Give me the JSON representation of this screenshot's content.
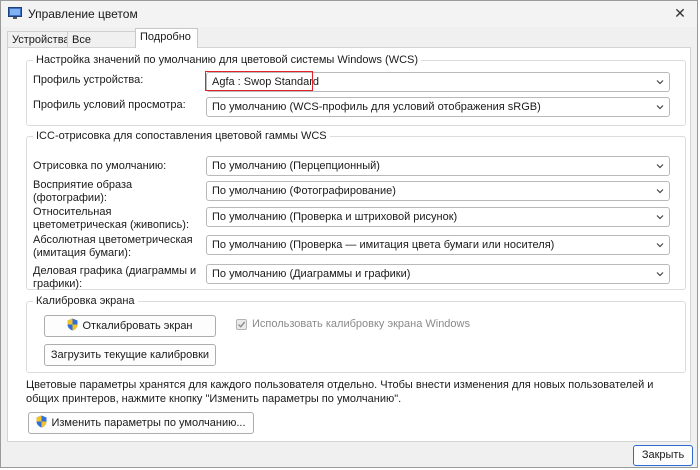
{
  "window": {
    "title": "Управление цветом"
  },
  "tabs": [
    {
      "label": "Устройства"
    },
    {
      "label": "Все профили"
    },
    {
      "label": "Подробно"
    }
  ],
  "wcs": {
    "legend": "Настройка значений по умолчанию для цветовой системы Windows (WCS)",
    "device_profile_label": "Профиль устройства:",
    "device_profile_value": "Agfa : Swop Standard",
    "viewing_profile_label": "Профиль условий просмотра:",
    "viewing_profile_value": "По умолчанию (WCS-профиль для условий отображения sRGB)"
  },
  "icc": {
    "legend": "ICC-отрисовка для сопоставления цветовой гаммы WCS",
    "rows": [
      {
        "label": "Отрисовка по умолчанию:",
        "value": "По умолчанию (Перцепционный)"
      },
      {
        "label": "Восприятие образа (фотографии):",
        "value": "По умолчанию (Фотографирование)"
      },
      {
        "label": "Относительная цветометрическая (живопись):",
        "value": "По умолчанию (Проверка и штриховой рисунок)"
      },
      {
        "label": "Абсолютная цветометрическая (имитация бумаги):",
        "value": "По умолчанию (Проверка — имитация цвета бумаги или носителя)"
      },
      {
        "label": "Деловая графика (диаграммы и графики):",
        "value": "По умолчанию (Диаграммы и графики)"
      }
    ]
  },
  "calibration": {
    "legend": "Калибровка экрана",
    "calibrate_button": "Откалибровать экран",
    "load_button": "Загрузить текущие калибровки",
    "use_windows_calibration_label": "Использовать калибровку экрана Windows",
    "use_windows_calibration_checked": true
  },
  "footer": {
    "info_text": "Цветовые параметры хранятся для каждого пользователя отдельно. Чтобы внести изменения для новых пользователей и общих принтеров, нажмите кнопку \"Изменить параметры по умолчанию\".",
    "change_defaults_button": "Изменить параметры по умолчанию...",
    "close_button": "Закрыть"
  },
  "icons": [
    "color-management-app-icon",
    "chevron-down-icon",
    "uac-shield-icon",
    "close-icon"
  ]
}
